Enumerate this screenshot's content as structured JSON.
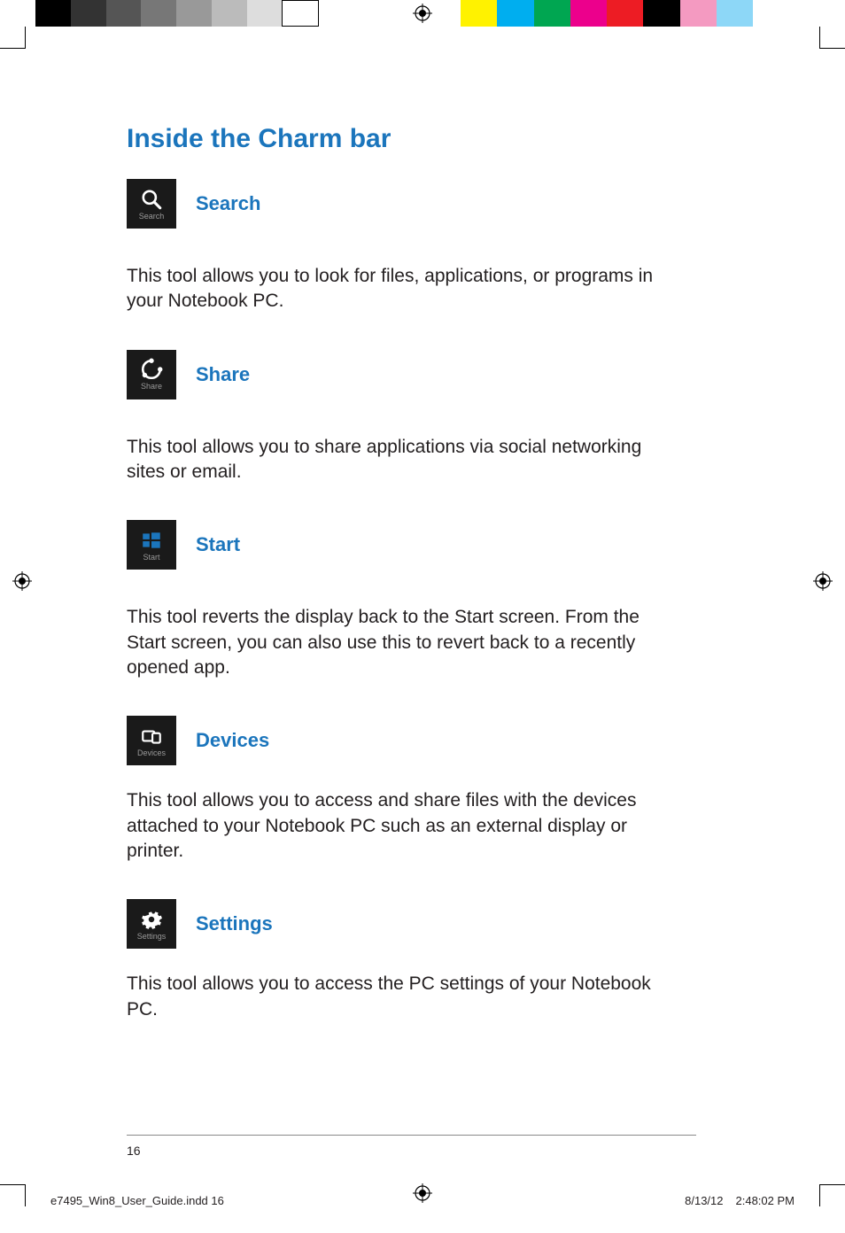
{
  "section_title": "Inside the Charm bar",
  "charms": {
    "search": {
      "tile_label": "Search",
      "title": "Search",
      "desc": "This tool allows you to look for files, applications, or programs in your Notebook PC."
    },
    "share": {
      "tile_label": "Share",
      "title": "Share",
      "desc": "This tool allows you to share applications via social networking sites or email."
    },
    "start": {
      "tile_label": "Start",
      "title": "Start",
      "desc": "This tool reverts the display back to the Start screen. From the Start screen, you can also use this to revert back to a recently opened app."
    },
    "devices": {
      "tile_label": "Devices",
      "title": "Devices",
      "desc": "This tool allows you to access and share files with the devices attached to your Notebook PC such as an external display or printer."
    },
    "settings": {
      "tile_label": "Settings",
      "title": "Settings",
      "desc": "This tool allows you to access the PC settings of your Notebook PC."
    }
  },
  "page_number": "16",
  "slug": {
    "file": "e7495_Win8_User_Guide.indd   16",
    "date": "8/13/12",
    "time": "2:48:02 PM"
  },
  "colors": {
    "accent": "#1b75bc",
    "body": "#231f20",
    "tile_bg": "#1a1a1a"
  }
}
